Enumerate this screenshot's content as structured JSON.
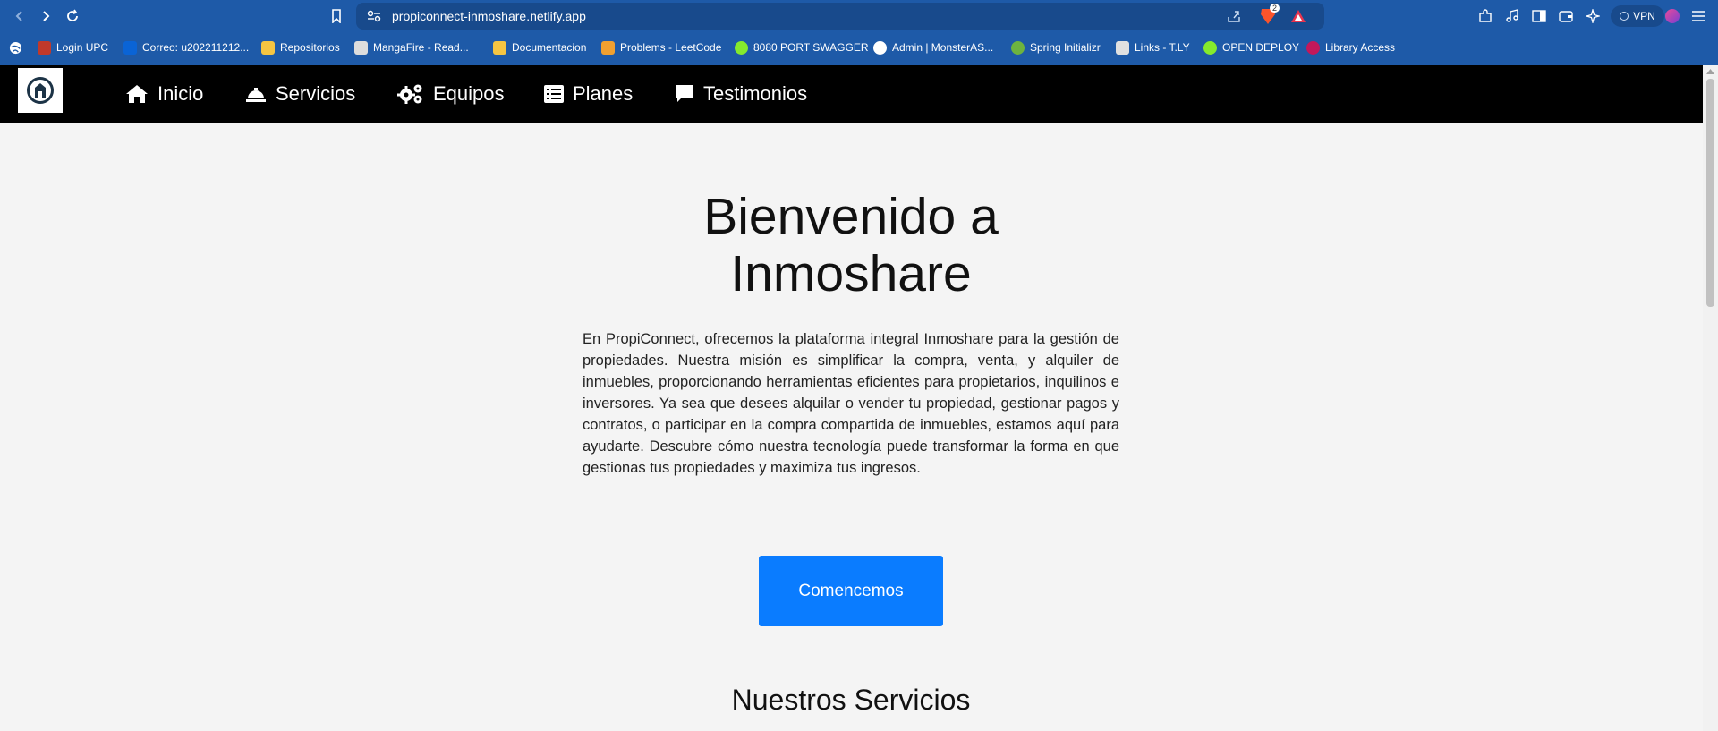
{
  "browser": {
    "url": "propiconnect-inmoshare.netlify.app",
    "vpn_label": "VPN",
    "brave_badge": "2",
    "bookmarks": [
      {
        "label": "Login UPC",
        "icon": "avatar-icon",
        "color": "#c0392b"
      },
      {
        "label": "Correo: u202211212...",
        "icon": "outlook-icon",
        "color": "#0a64d6"
      },
      {
        "label": "Repositorios",
        "icon": "folder-icon",
        "color": "#f5c542"
      },
      {
        "label": "MangaFire - Read...",
        "icon": "mangafire-icon",
        "color": "#dddddd"
      },
      {
        "label": "Documentacion",
        "icon": "folder-icon",
        "color": "#f5c542"
      },
      {
        "label": "Problems - LeetCode",
        "icon": "leetcode-icon",
        "color": "#f0a030"
      },
      {
        "label": "8080 PORT SWAGGER",
        "icon": "swagger-icon",
        "color": "#85ea2d"
      },
      {
        "label": "Admin | MonsterAS...",
        "icon": "globe-icon",
        "color": "#ffffff"
      },
      {
        "label": "Spring Initializr",
        "icon": "spring-icon",
        "color": "#6db33f"
      },
      {
        "label": "Links - T.LY",
        "icon": "tly-icon",
        "color": "#e0e0e0"
      },
      {
        "label": "OPEN DEPLOY",
        "icon": "swagger-icon",
        "color": "#85ea2d"
      },
      {
        "label": "Library Access",
        "icon": "library-icon",
        "color": "#c2185b"
      }
    ]
  },
  "nav": {
    "items": [
      {
        "label": "Inicio",
        "icon": "home-icon"
      },
      {
        "label": "Servicios",
        "icon": "service-bell-icon"
      },
      {
        "label": "Equipos",
        "icon": "gears-icon"
      },
      {
        "label": "Planes",
        "icon": "list-icon"
      },
      {
        "label": "Testimonios",
        "icon": "comment-icon"
      }
    ]
  },
  "hero": {
    "title": "Bienvenido a Inmoshare",
    "description": "En PropiConnect, ofrecemos la plataforma integral Inmoshare para la gestión de propiedades. Nuestra misión es simplificar la compra, venta, y alquiler de inmuebles, proporcionando herramientas eficientes para propietarios, inquilinos e inversores. Ya sea que desees alquilar o vender tu propiedad, gestionar pagos y contratos, o participar en la compra compartida de inmuebles, estamos aquí para ayudarte. Descubre cómo nuestra tecnología puede transformar la forma en que gestionas tus propiedades y maximiza tus ingresos.",
    "cta_label": "Comencemos"
  },
  "services": {
    "title": "Nuestros Servicios"
  },
  "colors": {
    "chrome": "#1e5aa8",
    "nav_bg": "#000000",
    "page_bg": "#f4f4f4",
    "cta": "#0a7cff"
  }
}
